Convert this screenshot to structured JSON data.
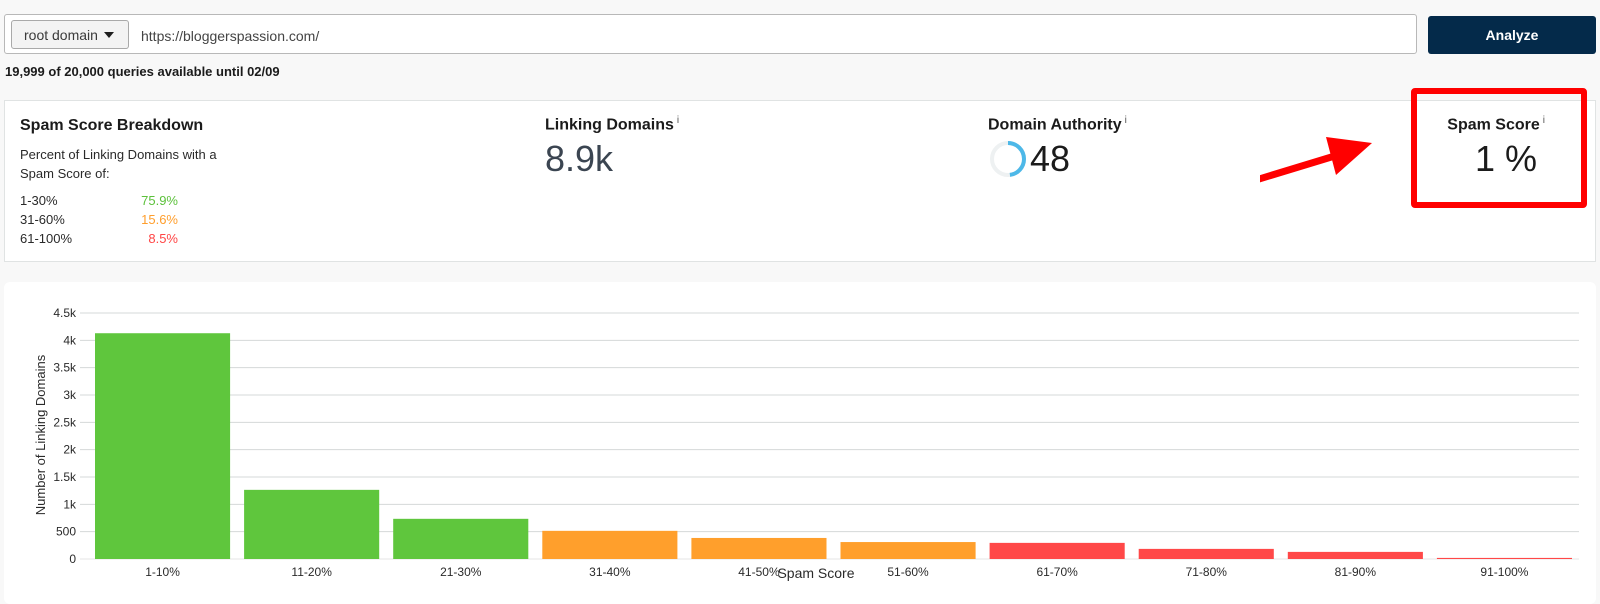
{
  "search": {
    "scope_selected": "root domain",
    "url_value": "https://bloggerspassion.com/",
    "analyze_label": "Analyze",
    "quota_text": "19,999 of 20,000 queries available until 02/09"
  },
  "breakdown": {
    "title": "Spam Score Breakdown",
    "description": "Percent of Linking Domains with a Spam Score of:",
    "rows": [
      {
        "range": "1-30%",
        "percent": "75.9%",
        "color": "#5cc13b"
      },
      {
        "range": "31-60%",
        "percent": "15.6%",
        "color": "#ff9e2c"
      },
      {
        "range": "61-100%",
        "percent": "8.5%",
        "color": "#ff4545"
      }
    ]
  },
  "metrics": {
    "linking_domains": {
      "label": "Linking Domains",
      "info": "i",
      "value": "8.9k"
    },
    "domain_authority": {
      "label": "Domain Authority",
      "info": "i",
      "value": "48",
      "gauge_fraction": 0.48,
      "gauge_color": "#4db8e8"
    },
    "spam_score": {
      "label": "Spam Score",
      "info": "i",
      "value": "1 %"
    }
  },
  "annotation": {
    "box_color": "#ff0000"
  },
  "chart_data": {
    "type": "bar",
    "title": "",
    "xlabel": "Spam Score",
    "ylabel": "Number of Linking Domains",
    "ylim": [
      0,
      4500
    ],
    "yticks": [
      0,
      500,
      1000,
      1500,
      2000,
      2500,
      3000,
      3500,
      4000,
      4500
    ],
    "ytick_labels": [
      "0",
      "500",
      "1k",
      "1.5k",
      "2k",
      "2.5k",
      "3k",
      "3.5k",
      "4k",
      "4.5k"
    ],
    "grid": true,
    "categories": [
      "1-10%",
      "11-20%",
      "21-30%",
      "31-40%",
      "41-50%",
      "51-60%",
      "61-70%",
      "71-80%",
      "81-90%",
      "91-100%"
    ],
    "values": [
      4130,
      1265,
      735,
      515,
      385,
      310,
      295,
      185,
      130,
      20
    ],
    "colors": [
      "#5fc63d",
      "#5fc63d",
      "#5fc63d",
      "#ff9f2c",
      "#ff9f2c",
      "#ff9f2c",
      "#ff4848",
      "#ff4848",
      "#ff4848",
      "#ff4848"
    ]
  }
}
